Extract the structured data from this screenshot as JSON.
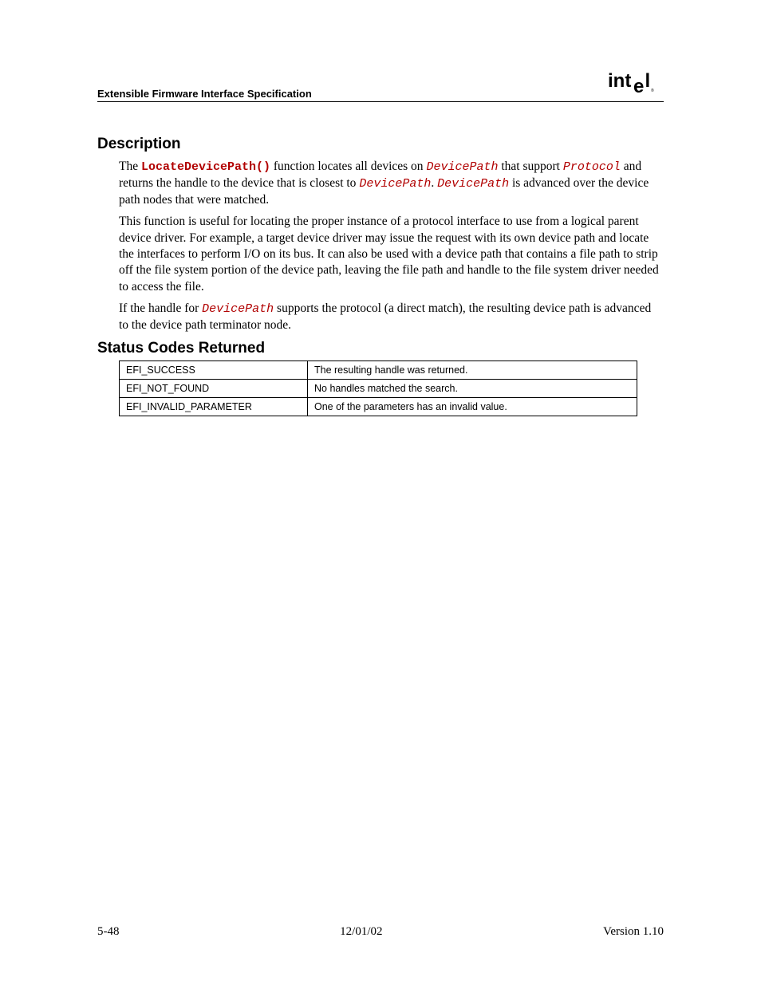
{
  "header": {
    "doc_title": "Extensible Firmware Interface Specification",
    "logo_text": "intel",
    "logo_reg": "®"
  },
  "sections": {
    "description_heading": "Description",
    "p1_a": "The ",
    "p1_func": "LocateDevicePath()",
    "p1_b": " function locates all devices on ",
    "p1_dp1": "DevicePath",
    "p1_c": " that support ",
    "p1_proto": "Protocol",
    "p1_d": " and returns the handle to the device that is closest to ",
    "p1_dp2": "DevicePath",
    "p1_e": ".  ",
    "p1_dp3": "DevicePath",
    "p1_f": " is advanced over the device path nodes that were matched.",
    "p2": "This function is useful for locating the proper instance of a protocol interface to use from a logical parent device driver.  For example, a target device driver may issue the request with its own device path and locate the interfaces to perform I/O on its bus.  It can also be used with a device path that contains a file path to strip off the file system portion of the device path, leaving the file path and handle to the file system driver needed to access the file.",
    "p3_a": "If the handle for ",
    "p3_dp": "DevicePath",
    "p3_b": " supports the protocol (a direct match), the resulting device path is advanced to the device path terminator node.",
    "status_heading": "Status Codes Returned"
  },
  "status_table": [
    {
      "code": "EFI_SUCCESS",
      "desc": "The resulting handle was returned."
    },
    {
      "code": "EFI_NOT_FOUND",
      "desc": "No handles matched the search."
    },
    {
      "code": "EFI_INVALID_PARAMETER",
      "desc": "One of the parameters has an invalid value."
    }
  ],
  "footer": {
    "page": "5-48",
    "date": "12/01/02",
    "version": "Version 1.10"
  }
}
